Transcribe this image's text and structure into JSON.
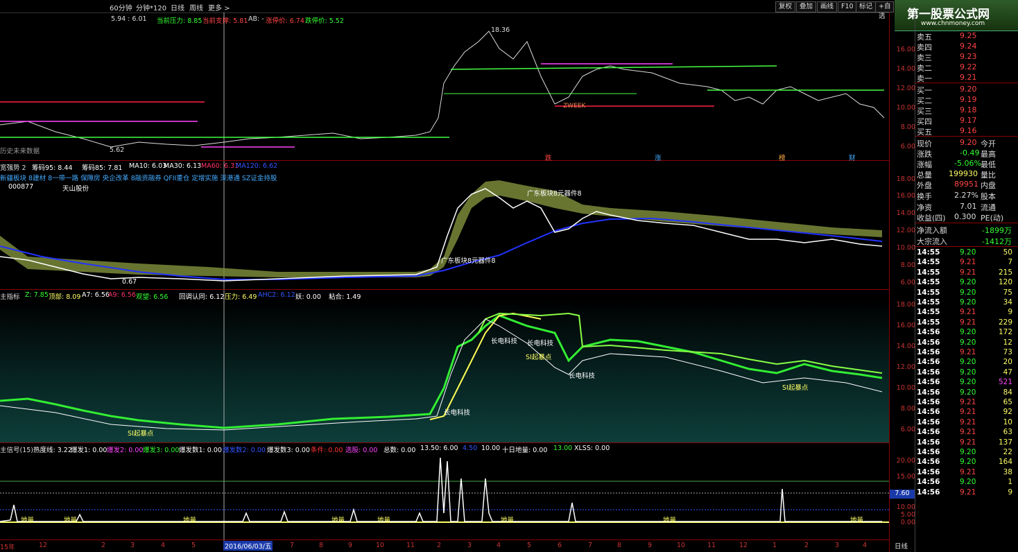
{
  "toolbar": {
    "items": [
      "60分钟",
      "分钟*120",
      "日线",
      "周线",
      "更多 >"
    ],
    "buttons": [
      "复权",
      "叠加",
      "画线",
      "F10",
      "标记",
      "+自选"
    ]
  },
  "banner": {
    "title": "第一股票公式网",
    "url": "www.chnmoney.com"
  },
  "panel1": {
    "header": [
      {
        "text": "5.94 : 6.01",
        "color": "#d0d0d0"
      },
      {
        "text": "当前压力: 8.85",
        "color": "#ff4444"
      },
      {
        "text": "当前支撑: 5.81",
        "color": "#ff4444"
      },
      {
        "text": "AB: -",
        "color": "#cccccc"
      },
      {
        "text": "涨停价: 6.74",
        "color": "#ff4444"
      },
      {
        "text": "跌停价: 5.52",
        "color": "#44ff44"
      }
    ],
    "peak_label": "18.36",
    "left_labels": [
      "历史未来数据",
      "5.62"
    ],
    "week_label": "ZWEEK",
    "yaxis": [
      "16.00",
      "14.00",
      "12.00",
      "10.00",
      "8.00",
      "6.00"
    ],
    "markers": [
      "跌",
      "涨",
      "榜",
      "财"
    ]
  },
  "panel2": {
    "header": [
      {
        "text": "宽强势 2",
        "color": "#cccccc"
      },
      {
        "text": "筹码95: 8.44",
        "color": "#ffffff"
      },
      {
        "text": "筹码85: 7.81",
        "color": "#ffffff"
      },
      {
        "text": "MA10: 6.03",
        "color": "#ffffff"
      },
      {
        "text": "MA30: 6.13",
        "color": "#ffffff"
      },
      {
        "text": "MA60: 6.31",
        "color": "#ff3366"
      },
      {
        "text": "MA120: 6.62",
        "color": "#3355ff"
      }
    ],
    "concepts": "新疆板块 8建材 8一带一路 保障房 央企改革 8融资融券 QFII重仓 定增实施 深港通 SZ证金持股",
    "stock_code": "000877",
    "stock_name": "天山股份",
    "annotations": [
      "广东板块8元器件8",
      "广东板块8元器件8"
    ],
    "extra_label": "0.67",
    "yaxis": [
      "18.00",
      "16.00",
      "14.00",
      "12.00",
      "10.00",
      "8.00",
      "6.00"
    ]
  },
  "panel3": {
    "header": [
      {
        "text": "主指标",
        "color": "#cccccc"
      },
      {
        "text": "Z: 7.85",
        "color": "#33ff33"
      },
      {
        "text": "顶部: 8.09",
        "color": "#ffff66"
      },
      {
        "text": "A7: 6.56",
        "color": "#ffffff"
      },
      {
        "text": "A9: 6.56",
        "color": "#ff3366"
      },
      {
        "text": "观望: 6.56",
        "color": "#33ff33"
      },
      {
        "text": "回调认同: 6.12",
        "color": "#ffffff"
      },
      {
        "text": "压力: 6.49",
        "color": "#ffff66"
      },
      {
        "text": "AHC2: 6.12",
        "color": "#3355ff"
      },
      {
        "text": "妖: 0.00",
        "color": "#ffffff"
      },
      {
        "text": "粘合: 1.49",
        "color": "#ffffff"
      }
    ],
    "annotations": [
      "长电科技",
      "长电科技",
      "SI起暴点",
      "长电科技",
      "SI起暴点",
      "长电科技",
      "SI起暴点"
    ],
    "yaxis": [
      "18.00",
      "16.00",
      "14.00",
      "12.00",
      "10.00",
      "8.00",
      "6.00"
    ]
  },
  "panel4": {
    "header": [
      {
        "text": "主信号(15)",
        "color": "#cccccc"
      },
      {
        "text": "热度线: 3.22",
        "color": "#ffffff"
      },
      {
        "text": "爆发1: 0.00",
        "color": "#ffffff"
      },
      {
        "text": "爆发2: 0.00",
        "color": "#ff44ff"
      },
      {
        "text": "爆发3: 0.00",
        "color": "#33ff33"
      },
      {
        "text": "爆发数1: 0.00",
        "color": "#ffffff"
      },
      {
        "text": "爆发数2: 0.00",
        "color": "#3355ff"
      },
      {
        "text": "爆发数3: 0.00",
        "color": "#ffffff"
      },
      {
        "text": "条件: 0.00",
        "color": "#ff3333"
      },
      {
        "text": "选股: 0.00",
        "color": "#ff44ff"
      },
      {
        "text": "总数: 0.00",
        "color": "#ffffff"
      },
      {
        "text": "13.50: 6.00",
        "color": "#ffffff"
      },
      {
        "text": "4.50",
        "color": "#3355ff"
      },
      {
        "text": "10.00",
        "color": "#ffffff"
      },
      {
        "text": "十日地量: 0.00",
        "color": "#ffffff"
      },
      {
        "text": "13.00",
        "color": "#33ff33"
      },
      {
        "text": "XLSS: 0.00",
        "color": "#ffffff"
      }
    ],
    "labels": [
      "地量",
      "地量",
      "地量",
      "地量",
      "地量",
      "地量",
      "地量",
      "地量"
    ],
    "yaxis": [
      "20.00",
      "15.00",
      "10.00",
      "5.00",
      "0.00"
    ],
    "cursor_value": "7.60"
  },
  "xaxis": {
    "labels": [
      "15年",
      "12",
      "2",
      "3",
      "4",
      "5",
      "6",
      "7",
      "8",
      "9",
      "10",
      "11",
      "12",
      "16年",
      "2",
      "3",
      "4",
      "5",
      "6",
      "7",
      "8",
      "9",
      "10",
      "11",
      "12",
      "1",
      "2",
      "3",
      "4"
    ],
    "cursor_date": "2016/06/03/五",
    "period": "日线"
  },
  "quotes": {
    "asks": [
      {
        "label": "卖五",
        "price": "9.25"
      },
      {
        "label": "卖四",
        "price": "9.24"
      },
      {
        "label": "卖三",
        "price": "9.23"
      },
      {
        "label": "卖二",
        "price": "9.22"
      },
      {
        "label": "卖一",
        "price": "9.21"
      }
    ],
    "bids": [
      {
        "label": "买一",
        "price": "9.20"
      },
      {
        "label": "买二",
        "price": "9.19"
      },
      {
        "label": "买三",
        "price": "9.18"
      },
      {
        "label": "买四",
        "price": "9.17"
      },
      {
        "label": "买五",
        "price": "9.16"
      }
    ],
    "stats": [
      {
        "l1": "现价",
        "v1": "9.20",
        "c1": "#ff4444",
        "l2": "今开",
        "v2": ""
      },
      {
        "l1": "涨跌",
        "v1": "-0.49",
        "c1": "#33ff33",
        "l2": "最高",
        "v2": ""
      },
      {
        "l1": "涨幅",
        "v1": "-5.06%",
        "c1": "#33ff33",
        "l2": "最低",
        "v2": ""
      },
      {
        "l1": "总量",
        "v1": "199930",
        "c1": "#ffff66",
        "l2": "量比",
        "v2": ""
      },
      {
        "l1": "外盘",
        "v1": "89951",
        "c1": "#ff4444",
        "l2": "内盘",
        "v2": ""
      },
      {
        "l1": "换手",
        "v1": "2.27%",
        "c1": "#dddddd",
        "l2": "股本",
        "v2": ""
      },
      {
        "l1": "净资",
        "v1": "7.01",
        "c1": "#dddddd",
        "l2": "流通",
        "v2": ""
      },
      {
        "l1": "收益(四)",
        "v1": "0.300",
        "c1": "#dddddd",
        "l2": "PE(动)",
        "v2": ""
      }
    ],
    "flows": [
      {
        "label": "净流入额",
        "value": "-1899万"
      },
      {
        "label": "大宗流入",
        "value": "-1412万"
      }
    ]
  },
  "ticks": [
    {
      "t": "14:55",
      "p": "9.20",
      "v": "50"
    },
    {
      "t": "14:55",
      "p": "9.21",
      "v": "7"
    },
    {
      "t": "14:55",
      "p": "9.21",
      "v": "215"
    },
    {
      "t": "14:55",
      "p": "9.20",
      "v": "120"
    },
    {
      "t": "14:55",
      "p": "9.20",
      "v": "75"
    },
    {
      "t": "14:55",
      "p": "9.20",
      "v": "34"
    },
    {
      "t": "14:55",
      "p": "9.21",
      "v": "9"
    },
    {
      "t": "14:55",
      "p": "9.21",
      "v": "229"
    },
    {
      "t": "14:56",
      "p": "9.20",
      "v": "172"
    },
    {
      "t": "14:56",
      "p": "9.20",
      "v": "12"
    },
    {
      "t": "14:56",
      "p": "9.21",
      "v": "73"
    },
    {
      "t": "14:56",
      "p": "9.20",
      "v": "20"
    },
    {
      "t": "14:56",
      "p": "9.20",
      "v": "47"
    },
    {
      "t": "14:56",
      "p": "9.20",
      "v": "521"
    },
    {
      "t": "14:56",
      "p": "9.20",
      "v": "84"
    },
    {
      "t": "14:56",
      "p": "9.21",
      "v": "65"
    },
    {
      "t": "14:56",
      "p": "9.21",
      "v": "92"
    },
    {
      "t": "14:56",
      "p": "9.21",
      "v": "10"
    },
    {
      "t": "14:56",
      "p": "9.21",
      "v": "63"
    },
    {
      "t": "14:56",
      "p": "9.21",
      "v": "137"
    },
    {
      "t": "14:56",
      "p": "9.20",
      "v": "22"
    },
    {
      "t": "14:56",
      "p": "9.20",
      "v": "164"
    },
    {
      "t": "14:56",
      "p": "9.21",
      "v": "38"
    },
    {
      "t": "14:56",
      "p": "9.20",
      "v": "1"
    },
    {
      "t": "14:56",
      "p": "9.21",
      "v": "9"
    }
  ],
  "colors": {
    "up": "#ff3333",
    "down": "#33ff33",
    "axis": "#8b0000",
    "ma120": "#2233ff",
    "cloud": "#7a8a3a"
  }
}
